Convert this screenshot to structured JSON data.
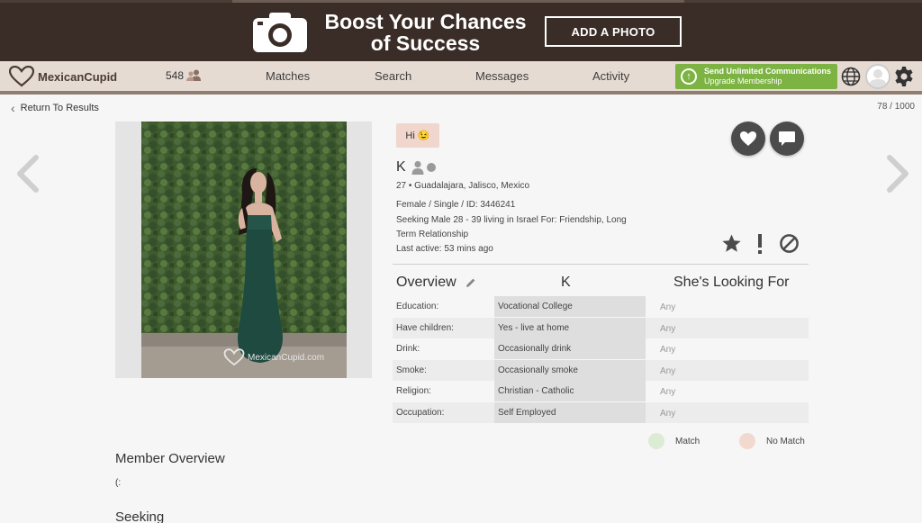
{
  "banner": {
    "headline_line1": "Boost Your Chances",
    "headline_line2": "of Success",
    "add_photo": "ADD A PHOTO"
  },
  "nav": {
    "brand": "MexicanCupid",
    "count": "548",
    "links": [
      "Matches",
      "Search",
      "Messages",
      "Activity"
    ],
    "upgrade_line1": "Send Unlimited Communications",
    "upgrade_line2": "Upgrade Membership",
    "upgrade_color": "#7cb342"
  },
  "subbar": {
    "back": "Return To Results",
    "position": "78 / 1000"
  },
  "photo": {
    "watermark": "MexicanCupid.com"
  },
  "profile": {
    "greeting": "Hi 😉",
    "name": "K",
    "age_location": "27 • Guadalajara, Jalisco, Mexico",
    "details": "Female / Single / ID: 3446241",
    "seeking_line1": "Seeking Male 28 - 39 living in Israel For: Friendship, Long",
    "seeking_line2": "Term Relationship",
    "last_active": "Last active: 53 mins ago"
  },
  "table": {
    "head_overview": "Overview",
    "head_name": "K",
    "head_looking": "She's Looking For",
    "rows": [
      {
        "label": "Education:",
        "value": "Vocational College",
        "want": "Any"
      },
      {
        "label": "Have children:",
        "value": "Yes - live at home",
        "want": "Any"
      },
      {
        "label": "Drink:",
        "value": "Occasionally drink",
        "want": "Any"
      },
      {
        "label": "Smoke:",
        "value": "Occasionally smoke",
        "want": "Any"
      },
      {
        "label": "Religion:",
        "value": "Christian - Catholic",
        "want": "Any"
      },
      {
        "label": "Occupation:",
        "value": "Self Employed",
        "want": "Any"
      }
    ]
  },
  "legend": {
    "match": "Match",
    "no_match": "No Match",
    "match_color": "#dcebd3",
    "no_match_color": "#f2d9d0"
  },
  "member_overview": {
    "title": "Member Overview",
    "text": "(:"
  },
  "seeking": {
    "title": "Seeking"
  }
}
